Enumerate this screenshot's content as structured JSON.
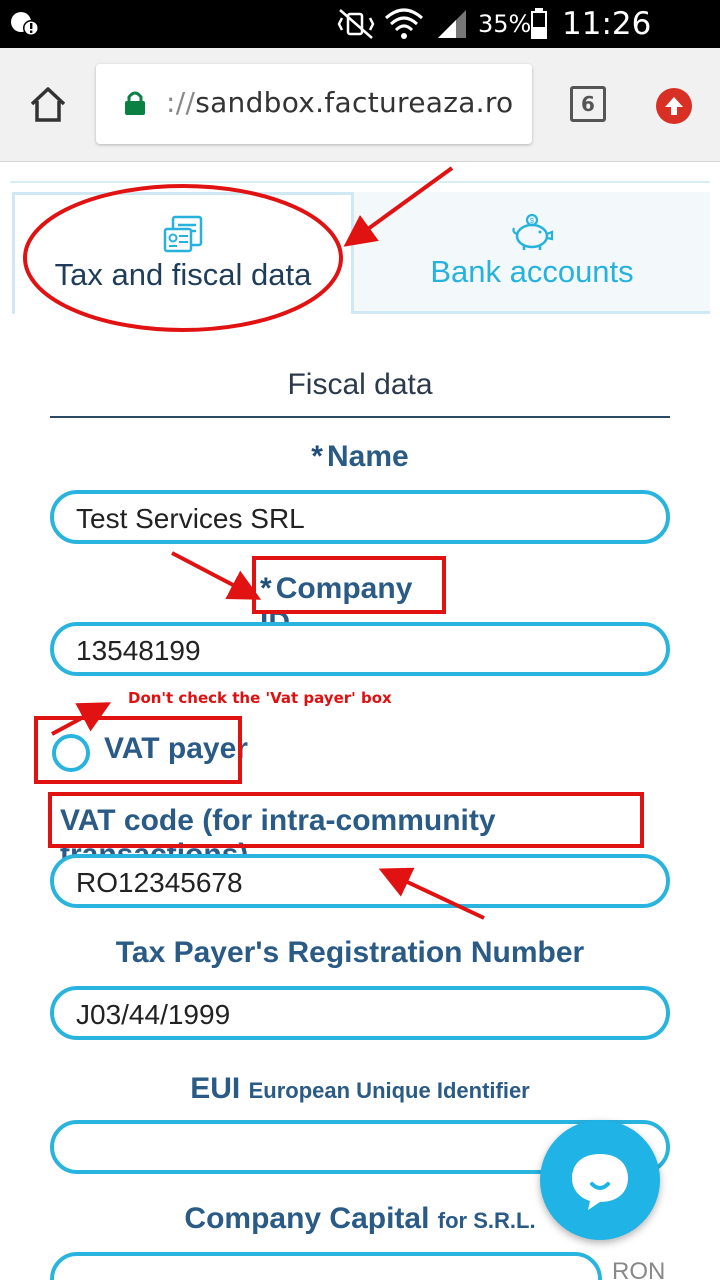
{
  "status_bar": {
    "battery": "35%",
    "time": "11:26 a.m."
  },
  "browser": {
    "url_scheme": "://",
    "url_host": "sandbox.factureaza.ro",
    "tab_count": "6"
  },
  "tabs": [
    {
      "label": "Tax and fiscal data",
      "active": true
    },
    {
      "label": "Bank accounts",
      "active": false
    }
  ],
  "form": {
    "section_title": "Fiscal data",
    "required_marker": "*",
    "name": {
      "label": "Name",
      "value": "Test Services SRL"
    },
    "company_id": {
      "label": "Company ID",
      "value": "13548199"
    },
    "vat_payer": {
      "label": "VAT payer",
      "checked": false
    },
    "vat_code": {
      "label": "VAT code (for intra-community transactions)",
      "value": "RO12345678"
    },
    "registration": {
      "label": "Tax Payer's Registration Number",
      "value": "J03/44/1999"
    },
    "eui": {
      "label": "EUI",
      "label_small": "European Unique Identifier",
      "value": ""
    },
    "capital": {
      "label": "Company Capital",
      "label_small": "for S.R.L.",
      "value": "",
      "currency": "RON"
    }
  },
  "annotation_note": "Don't check the 'Vat payer' box",
  "colors": {
    "accent": "#29b4e0",
    "label": "#2a5a86",
    "annotation": "#e01212"
  }
}
